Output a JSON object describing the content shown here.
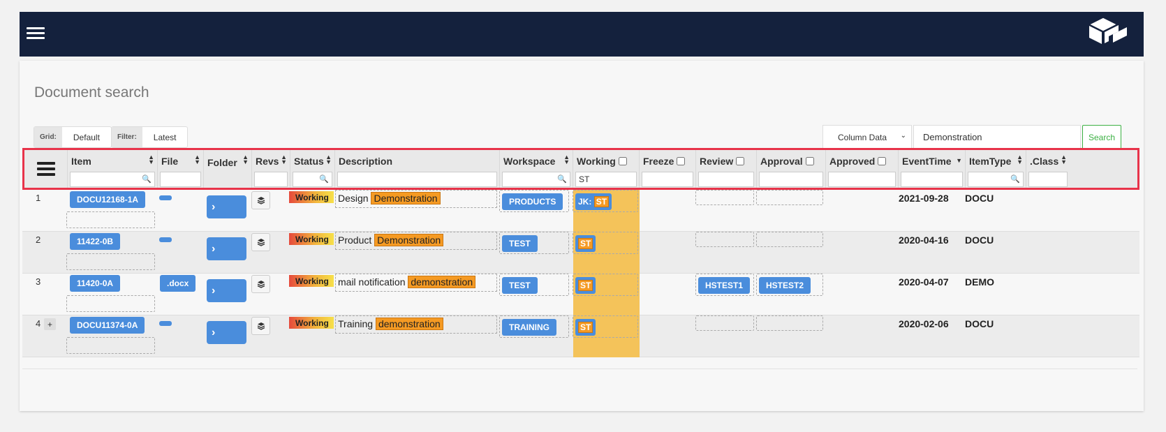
{
  "app": {
    "menu_icon": "hamburger-icon",
    "logo_icon": "cube-logo-icon"
  },
  "page": {
    "title": "Document search"
  },
  "grid_selector": {
    "label": "Grid:",
    "value": "Default"
  },
  "filter_selector": {
    "label": "Filter:",
    "value": "Latest"
  },
  "search": {
    "column_select": "Column Data",
    "query": "Demonstration",
    "button": "Search"
  },
  "columns": [
    {
      "key": "item",
      "label": "Item"
    },
    {
      "key": "file",
      "label": "File"
    },
    {
      "key": "folder",
      "label": "Folder"
    },
    {
      "key": "revs",
      "label": "Revs"
    },
    {
      "key": "status",
      "label": "Status"
    },
    {
      "key": "description",
      "label": "Description"
    },
    {
      "key": "workspace",
      "label": "Workspace"
    },
    {
      "key": "working",
      "label": "Working"
    },
    {
      "key": "freeze",
      "label": "Freeze"
    },
    {
      "key": "review",
      "label": "Review"
    },
    {
      "key": "approval",
      "label": "Approval"
    },
    {
      "key": "approved",
      "label": "Approved"
    },
    {
      "key": "eventtime",
      "label": "EventTime"
    },
    {
      "key": "itemtype",
      "label": "ItemType"
    },
    {
      "key": "class",
      "label": ".Class"
    }
  ],
  "filters": {
    "working": "ST"
  },
  "rows": [
    {
      "num": "1",
      "item": "DOCU12168-1A",
      "file": "",
      "status": "Working",
      "desc_prefix": "Design",
      "desc_match": "Demonstration",
      "workspace": "PRODUCTS",
      "working_prefix": "JK:",
      "working_tag": "ST",
      "review": "",
      "approval": "",
      "eventtime": "2021-09-28",
      "itemtype": "DOCU",
      "expand": ""
    },
    {
      "num": "2",
      "item": "11422-0B",
      "file": "",
      "status": "Working",
      "desc_prefix": "Product",
      "desc_match": "Demonstration",
      "workspace": "TEST",
      "working_prefix": "",
      "working_tag": "ST",
      "review": "",
      "approval": "",
      "eventtime": "2020-04-16",
      "itemtype": "DOCU",
      "expand": ""
    },
    {
      "num": "3",
      "item": "11420-0A",
      "file": ".docx",
      "status": "Working",
      "desc_prefix": "mail notification",
      "desc_match": "demonstration",
      "workspace": "TEST",
      "working_prefix": "",
      "working_tag": "ST",
      "review": "HSTEST1",
      "approval": "HSTEST2",
      "eventtime": "2020-04-07",
      "itemtype": "DEMO",
      "expand": ""
    },
    {
      "num": "4",
      "item": "DOCU11374-0A",
      "file": "",
      "status": "Working",
      "desc_prefix": "Training",
      "desc_match": "demonstration",
      "workspace": "TRAINING",
      "working_prefix": "",
      "working_tag": "ST",
      "review": "",
      "approval": "",
      "eventtime": "2020-02-06",
      "itemtype": "DOCU",
      "expand": "+"
    }
  ]
}
